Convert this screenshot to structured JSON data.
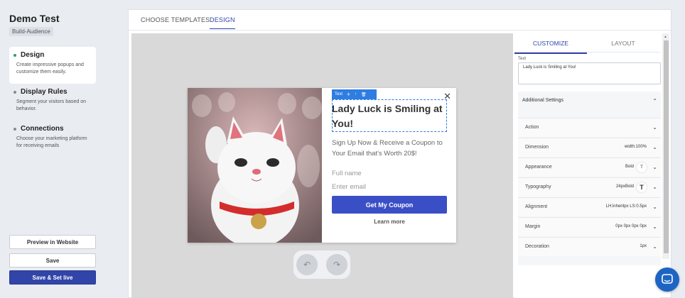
{
  "sidebar": {
    "title": "Demo Test",
    "tag": "Build-Audience",
    "steps": [
      {
        "title": "Design",
        "desc": "Create impressive popups and customize them easily."
      },
      {
        "title": "Display Rules",
        "desc": "Segment your visitors based on behavior."
      },
      {
        "title": "Connections",
        "desc": "Choose your marketing platform for receiving emails"
      }
    ],
    "buttons": {
      "preview": "Preview in Website",
      "save": "Save",
      "save_live": "Save & Set live"
    }
  },
  "main_tabs": [
    "CHOOSE TEMPLATES",
    "DESIGN"
  ],
  "popup": {
    "toolbar_label": "Text",
    "heading": "Lady Luck is Smiling at You!",
    "subtext": "Sign Up Now & Receive a Coupon to Your Email that's Worth 20$!",
    "name_placeholder": "Full name",
    "email_placeholder": "Enter email",
    "cta": "Get My Coupon",
    "learn_more": "Learn more"
  },
  "right_panel": {
    "tabs": [
      "CUSTOMIZE",
      "LAYOUT"
    ],
    "text_label": "Text",
    "text_value": "Lady Luck is Smiling at You!",
    "settings_title": "Additional Settings",
    "rows": [
      {
        "label": "Action",
        "value": ""
      },
      {
        "label": "Dimension",
        "value": "width:100%"
      },
      {
        "label": "Appearance",
        "value": "Bold"
      },
      {
        "label": "Typography",
        "value": "24pxBold"
      },
      {
        "label": "Alignment",
        "value": "LH:inheritpx LS:0.5px"
      },
      {
        "label": "Margin",
        "value": "0px 0px 0px 0px"
      },
      {
        "label": "Decoration",
        "value": "1px"
      }
    ]
  },
  "colors": {
    "accent": "#3144a8",
    "cta": "#3a4fc6",
    "active_dot": "#28a06a",
    "selection": "#2e7de1"
  }
}
